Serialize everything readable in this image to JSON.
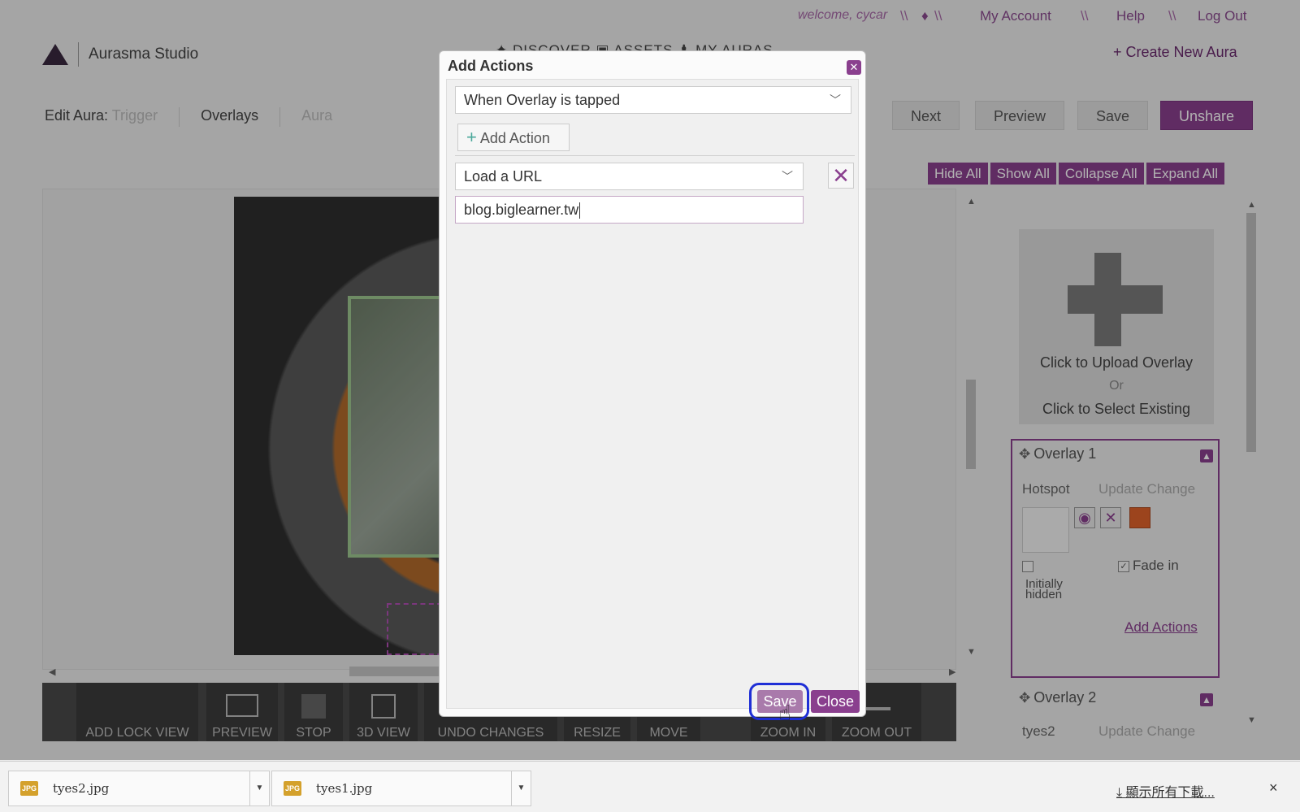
{
  "topbar": {
    "welcome": "welcome, cycar",
    "separator": "\\\\",
    "pin": "♦",
    "my_account": "My Account",
    "help": "Help",
    "logout": "Log Out"
  },
  "brand": {
    "name": "Aurasma Studio"
  },
  "main_nav": {
    "text": "✦ DISCOVER  ▣ ASSETS  ♟ MY AURAS"
  },
  "create_new": "+ Create New Aura",
  "edit_bar": {
    "label": "Edit Aura:",
    "steps": [
      "Trigger",
      "Overlays",
      "Aura"
    ]
  },
  "top_buttons": {
    "next": "Next",
    "preview": "Preview",
    "save": "Save",
    "unshare": "Unshare"
  },
  "panel_buttons": [
    "Hide All",
    "Show All",
    "Collapse All",
    "Expand All"
  ],
  "toolbar": [
    "ADD LOCK VIEW",
    "PREVIEW",
    "STOP",
    "3D VIEW",
    "UNDO CHANGES",
    "RESIZE",
    "MOVE",
    "ZOOM IN",
    "ZOOM OUT"
  ],
  "right_panel": {
    "upload": "Click to Upload Overlay",
    "or": "Or",
    "select_existing": "Click to Select Existing",
    "overlay1": {
      "title": "Overlay 1",
      "type": "Hotspot",
      "update": "Update Change",
      "initially_hidden": "Initially hidden",
      "fade_in": "Fade in",
      "add_actions": "Add Actions"
    },
    "overlay2": {
      "title": "Overlay 2",
      "name": "tyes2",
      "update": "Update Change"
    }
  },
  "modal": {
    "title": "Add Actions",
    "trigger_select": "When Overlay is tapped",
    "add_action": "Add Action",
    "action_select": "Load a URL",
    "url_value": "blog.biglearner.tw",
    "save": "Save",
    "close": "Close"
  },
  "downloads": {
    "items": [
      {
        "file_label": "JPG",
        "name": "tyes2.jpg"
      },
      {
        "file_label": "JPG",
        "name": "tyes1.jpg"
      }
    ],
    "show_all": "⤓ 顯示所有下載...",
    "close": "×"
  },
  "colors": {
    "accent": "#8a3f8e",
    "highlight_ring": "#1f2fd6",
    "swatch": "#e0622a"
  }
}
